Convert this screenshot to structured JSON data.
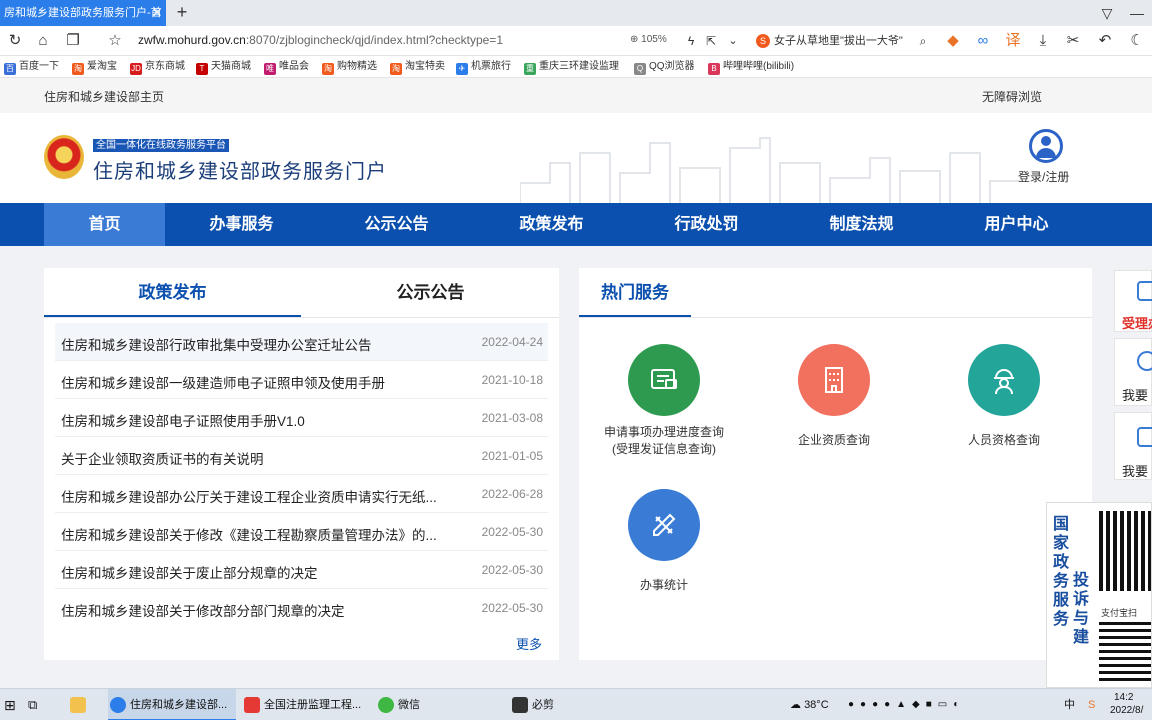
{
  "browser": {
    "tab_title": "房和城乡建设部政务服务门户-首",
    "url_host": "zwfw.mohurd.gov.cn",
    "url_path": ":8070/zjblogincheck/qjd/index.html?checktype=1",
    "zoom": "105%",
    "search_text": "女子从草地里\"拔出一大爷\"",
    "bookmarks": [
      "百度一下",
      "爱淘宝",
      "京东商城",
      "天猫商城",
      "唯品会",
      "购物精选",
      "淘宝特卖",
      "机票旅行",
      "重庆三环建设监理",
      "QQ浏览器",
      "哔哩哔哩(bilibili)"
    ]
  },
  "topstrip": {
    "home_link": "住房和城乡建设部主页",
    "accessibility": "无障碍浏览"
  },
  "header": {
    "badge": "全国一体化在线政务服务平台",
    "title": "住房和城乡建设部政务服务门户",
    "login": "登录/注册"
  },
  "nav": [
    "首页",
    "办事服务",
    "公示公告",
    "政策发布",
    "行政处罚",
    "制度法规",
    "用户中心"
  ],
  "left_panel": {
    "tabs": [
      "政策发布",
      "公示公告"
    ],
    "news": [
      {
        "title": "住房和城乡建设部行政审批集中受理办公室迁址公告",
        "date": "2022-04-24"
      },
      {
        "title": "住房和城乡建设部一级建造师电子证照申领及使用手册",
        "date": "2021-10-18"
      },
      {
        "title": "住房和城乡建设部电子证照使用手册V1.0",
        "date": "2021-03-08"
      },
      {
        "title": "关于企业领取资质证书的有关说明",
        "date": "2021-01-05"
      },
      {
        "title": "住房和城乡建设部办公厅关于建设工程企业资质申请实行无纸...",
        "date": "2022-06-28"
      },
      {
        "title": "住房和城乡建设部关于修改《建设工程勘察质量管理办法》的...",
        "date": "2022-05-30"
      },
      {
        "title": "住房和城乡建设部关于废止部分规章的决定",
        "date": "2022-05-30"
      },
      {
        "title": "住房和城乡建设部关于修改部分部门规章的决定",
        "date": "2022-05-30"
      }
    ],
    "more": "更多"
  },
  "right_panel": {
    "title": "热门服务",
    "services": [
      {
        "label_line1": "申请事项办理进度查询",
        "label_line2": "(受理发证信息查询)",
        "color": "#2e9a4f",
        "icon": "progress-query-icon"
      },
      {
        "label_line1": "企业资质查询",
        "label_line2": "",
        "color": "#f2705e",
        "icon": "building-icon"
      },
      {
        "label_line1": "人员资格查询",
        "label_line2": "",
        "color": "#23a59a",
        "icon": "worker-helmet-icon"
      },
      {
        "label_line1": "办事统计",
        "label_line2": "",
        "color": "#3a7bd5",
        "icon": "pencil-ruler-icon"
      }
    ]
  },
  "float_sidebar": [
    "受理办",
    "我要",
    "我要"
  ],
  "qr_widget": {
    "vertical_text": "国家政务服务",
    "vertical_text2": "投诉与建",
    "caption": "支付宝扫"
  },
  "taskbar": {
    "apps": [
      "住房和城乡建设部...",
      "全国注册监理工程...",
      "微信",
      "必剪"
    ],
    "weather": "38°C",
    "ime": "中",
    "time": "14:2",
    "date": "2022/8/"
  },
  "colors": {
    "nav_blue": "#0b50ae",
    "nav_active": "#3a7bd5",
    "tab_blue": "#2b7de9"
  }
}
